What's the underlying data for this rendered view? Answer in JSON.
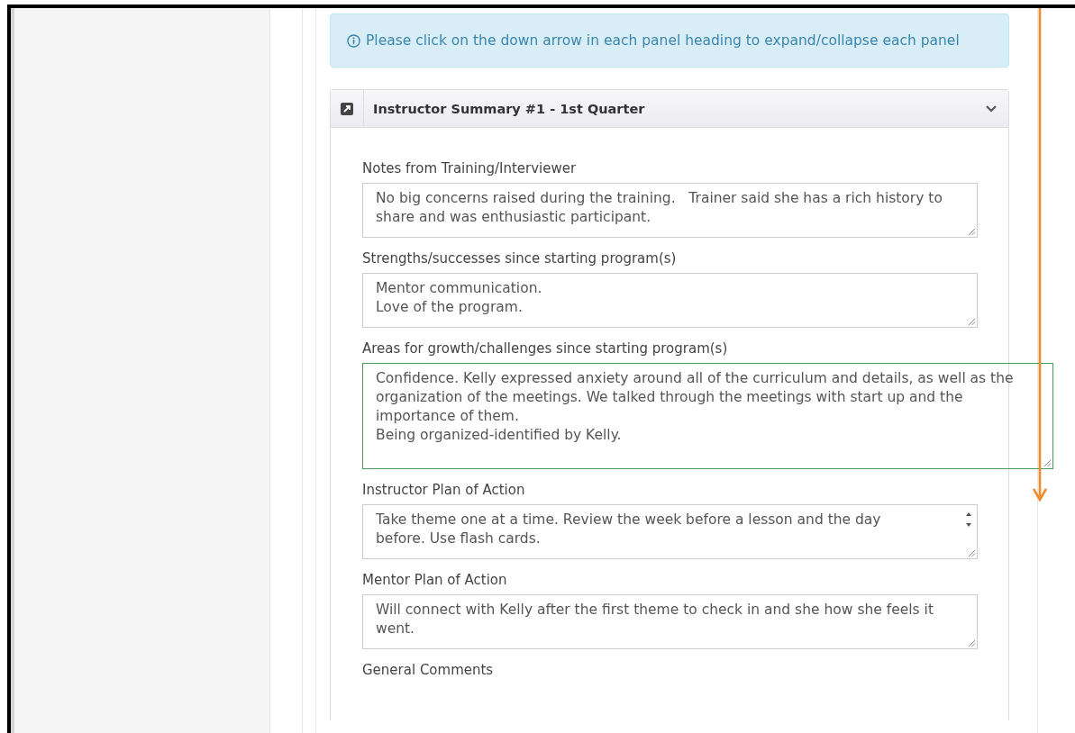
{
  "info_alert": {
    "text": "Please click on the down arrow in each panel heading to expand/collapse each panel"
  },
  "panel": {
    "title": "Instructor Summary #1 - 1st Quarter",
    "expanded": true,
    "fields": [
      {
        "label": "Notes from Training/Interviewer",
        "value": "No big concerns raised during the training.   Trainer said she has a rich history to share and was enthusiastic participant.",
        "focused": false,
        "scrollbar": false
      },
      {
        "label": "Strengths/successes since starting program(s)",
        "value": "Mentor communication.\nLove of the program.",
        "focused": false,
        "scrollbar": false
      },
      {
        "label": "Areas for growth/challenges since starting program(s)",
        "value": "Confidence. Kelly expressed anxiety around all of the curriculum and details, as well as the organization of the meetings. We talked through the meetings with start up and the importance of them.\nBeing organized-identified by Kelly.",
        "focused": true,
        "scrollbar": false
      },
      {
        "label": "Instructor Plan of Action",
        "value": "Take theme one at a time. Review the week before a lesson and the day before. Use flash cards.",
        "focused": false,
        "scrollbar": true
      },
      {
        "label": "Mentor Plan of Action",
        "value": "Will connect with Kelly after the first theme to check in and she how she feels it went.",
        "focused": false,
        "scrollbar": false
      },
      {
        "label": "General Comments"
      }
    ]
  }
}
